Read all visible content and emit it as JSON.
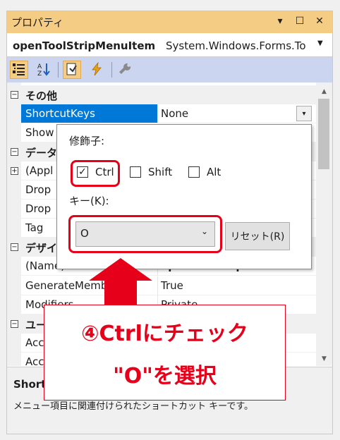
{
  "window": {
    "title": "プロパティ",
    "title_buttons": [
      "▾",
      "☐",
      "✕"
    ]
  },
  "object_selector": {
    "name": "openToolStripMenuItem",
    "type": "System.Windows.Forms.To"
  },
  "toolbar": {
    "icons": [
      "categorized-icon",
      "alphabetical-icon",
      "properties-icon",
      "events-icon",
      "property-pages-icon"
    ]
  },
  "grid": {
    "cat_other": "その他",
    "shortcut_keys": {
      "name": "ShortcutKeys",
      "value": "None"
    },
    "show_partial": "Show",
    "cat_data_partial": "データ",
    "appl_partial": "(Appl",
    "drop1_partial": "Drop",
    "drop2_partial": "Drop",
    "tag": "Tag",
    "cat_design_partial": "デザイ",
    "name_row": {
      "name": "(Name)",
      "value_partial": "openToolStripMenuItem"
    },
    "generate_member": {
      "name": "GenerateMember",
      "value": "True"
    },
    "modifiers": {
      "name": "Modifiers",
      "value": "Private"
    },
    "cat_user_partial": "ユー",
    "acc1_partial": "Acc",
    "acc2_partial": "Acc"
  },
  "description": {
    "title_partial": "Short",
    "text": "メニュー項目に関連付けられたショートカット キーです。"
  },
  "popup": {
    "modifiers_label": "修飾子:",
    "ctrl": {
      "label": "Ctrl",
      "checked": true
    },
    "shift": {
      "label": "Shift",
      "checked": false
    },
    "alt": {
      "label": "Alt",
      "checked": false
    },
    "key_label": "キー(K):",
    "key_value": "O",
    "reset_label": "リセット(R)"
  },
  "callout": {
    "line1": "④Ctrlにチェック",
    "line2": "\"O\"を選択"
  },
  "colors": {
    "accent_title": "#f5cc84",
    "toolbar": "#ccd5f0",
    "selection": "#0078d7",
    "highlight_red": "#e6001a"
  }
}
